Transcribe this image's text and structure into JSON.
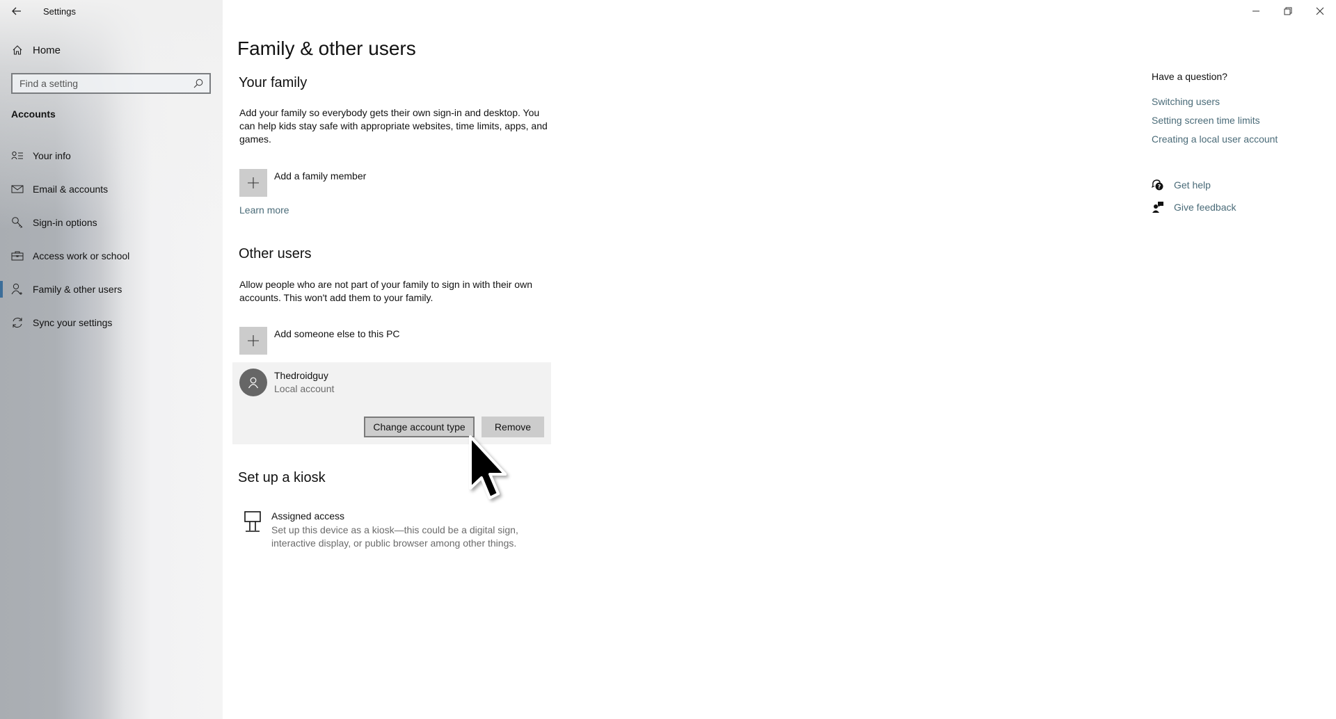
{
  "window": {
    "title": "Settings",
    "controls": {
      "minimize": "minimize-icon",
      "restore": "restore-icon",
      "close": "close-icon"
    }
  },
  "sidebar": {
    "home_label": "Home",
    "search": {
      "placeholder": "Find a setting",
      "value": ""
    },
    "section_title": "Accounts",
    "items": [
      {
        "label": "Your info",
        "icon": "contact-info-icon",
        "selected": false
      },
      {
        "label": "Email & accounts",
        "icon": "mail-icon",
        "selected": false
      },
      {
        "label": "Sign-in options",
        "icon": "key-icon",
        "selected": false
      },
      {
        "label": "Access work or school",
        "icon": "briefcase-icon",
        "selected": false
      },
      {
        "label": "Family & other users",
        "icon": "add-person-icon",
        "selected": true
      },
      {
        "label": "Sync your settings",
        "icon": "sync-icon",
        "selected": false
      }
    ],
    "accent_color": "#3c6e99"
  },
  "main": {
    "page_title": "Family & other users",
    "your_family": {
      "heading": "Your family",
      "description_lines": [
        "Add your family so everybody gets their own sign-in and desktop. You",
        "can help kids stay safe with appropriate websites, time limits, apps, and",
        "games."
      ],
      "add_label": "Add a family member",
      "learn_more": "Learn more"
    },
    "other_users": {
      "heading": "Other users",
      "description_lines": [
        "Allow people who are not part of your family to sign in with their own",
        "accounts. This won't add them to your family."
      ],
      "add_label": "Add someone else to this PC",
      "users": [
        {
          "name": "Thedroidguy",
          "account_type": "Local account",
          "actions": {
            "change_type": "Change account type",
            "remove": "Remove"
          }
        }
      ]
    },
    "kiosk": {
      "heading": "Set up a kiosk",
      "item_title": "Assigned access",
      "item_description_lines": [
        "Set up this device as a kiosk—this could be a digital sign,",
        "interactive display, or public browser among other things."
      ]
    }
  },
  "help_panel": {
    "heading": "Have a question?",
    "links": [
      "Switching users",
      "Setting screen time limits",
      "Creating a local user account"
    ],
    "get_help": "Get help",
    "give_feedback": "Give feedback",
    "link_color": "#4a6b78"
  }
}
